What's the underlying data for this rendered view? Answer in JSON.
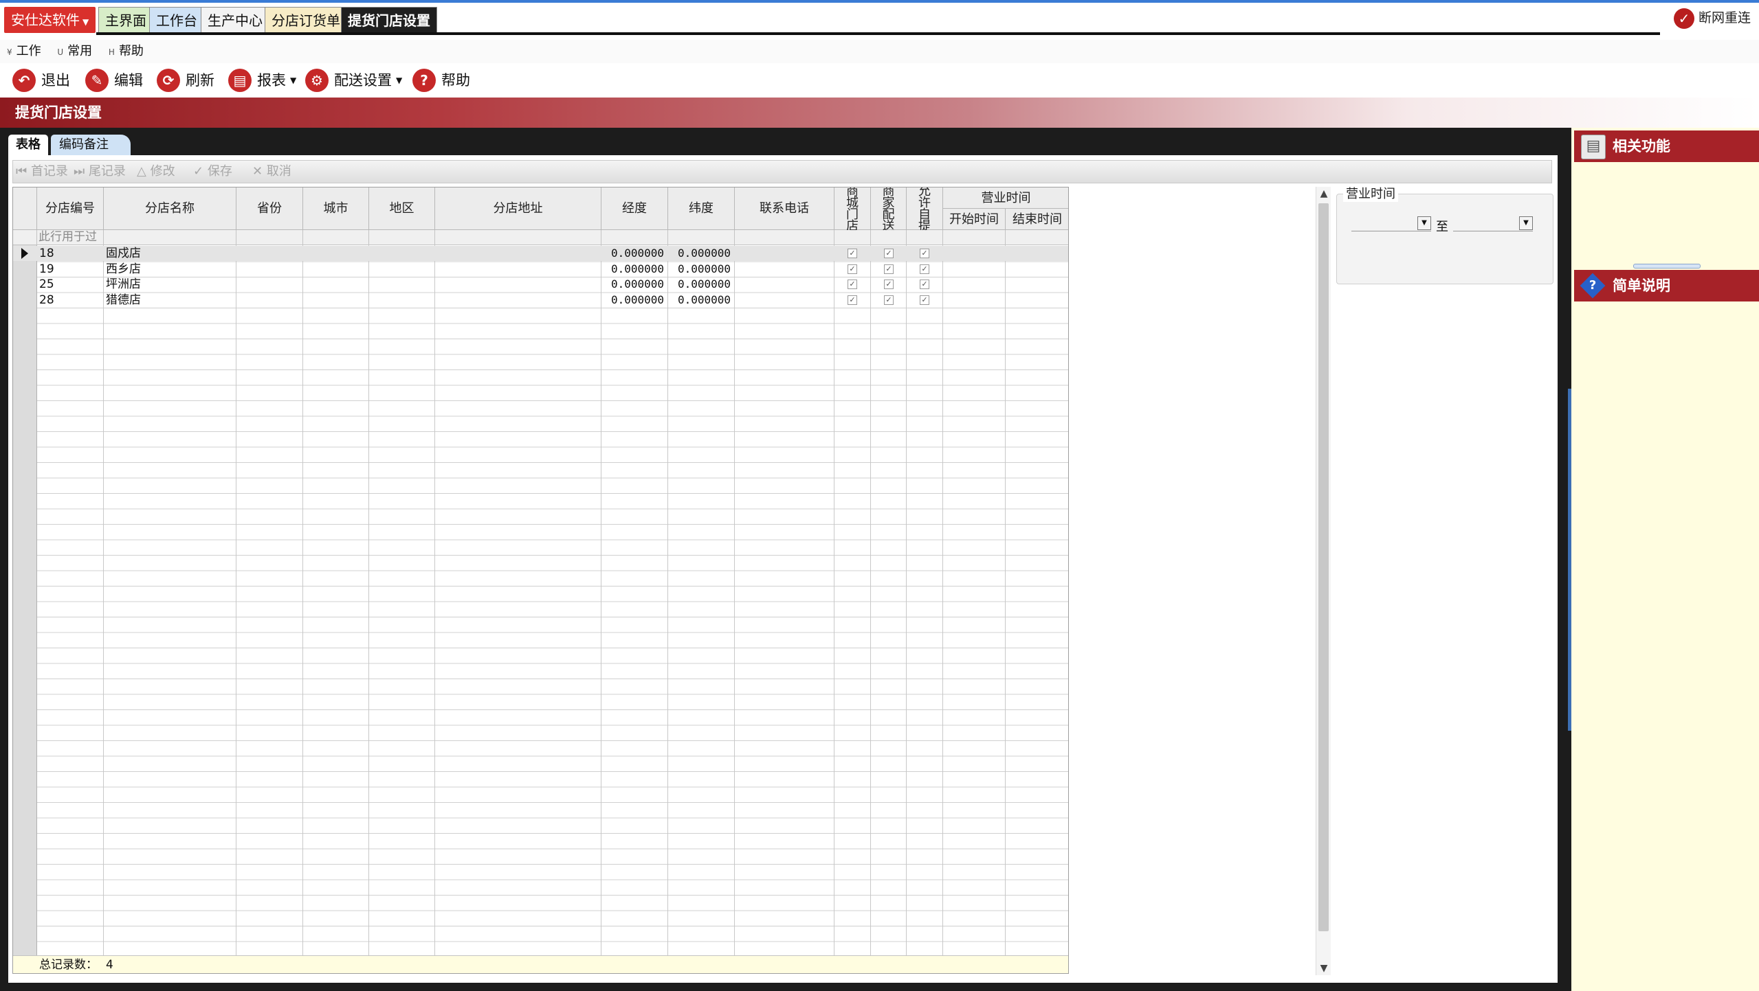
{
  "app": {
    "brand": "安仕达软件",
    "tabs": [
      "主界面",
      "工作台",
      "生产中心",
      "分店订货单",
      "提货门店设置"
    ],
    "active_tab": "提货门店设置",
    "reconnect_label": "断网重连"
  },
  "menu": [
    "工作",
    "常用",
    "帮助"
  ],
  "toolbar": {
    "exit": "退出",
    "edit": "编辑",
    "refresh": "刷新",
    "report": "报表",
    "delivery_settings": "配送设置",
    "help": "帮助"
  },
  "page_title": "提货门店设置",
  "subtabs": [
    "表格",
    "编码备注"
  ],
  "navigator": {
    "first": "首记录",
    "last": "尾记录",
    "modify": "修改",
    "save": "保存",
    "cancel": "取消"
  },
  "grid": {
    "columns": {
      "code": "分店编号",
      "name": "分店名称",
      "province": "省份",
      "city": "城市",
      "district": "地区",
      "address": "分店地址",
      "longitude": "经度",
      "latitude": "纬度",
      "phone": "联系电话",
      "mall_store": "商城门店",
      "merchant_delivery": "商家配送",
      "allow_pickup": "允许自提",
      "hours_group": "营业时间",
      "start_time": "开始时间",
      "end_time": "结束时间"
    },
    "filter_placeholder": "此行用于过",
    "rows": [
      {
        "code": "18",
        "name": "固戍店",
        "longitude": "0.000000",
        "latitude": "0.000000",
        "mall_store": true,
        "merchant_delivery": true,
        "allow_pickup": true
      },
      {
        "code": "19",
        "name": "西乡店",
        "longitude": "0.000000",
        "latitude": "0.000000",
        "mall_store": true,
        "merchant_delivery": true,
        "allow_pickup": true
      },
      {
        "code": "25",
        "name": "坪洲店",
        "longitude": "0.000000",
        "latitude": "0.000000",
        "mall_store": true,
        "merchant_delivery": true,
        "allow_pickup": true
      },
      {
        "code": "28",
        "name": "猎德店",
        "longitude": "0.000000",
        "latitude": "0.000000",
        "mall_store": true,
        "merchant_delivery": true,
        "allow_pickup": true
      }
    ],
    "footer_label": "总记录数：",
    "footer_count": "4"
  },
  "hours_panel": {
    "legend": "营业时间",
    "to_label": "至",
    "from_value": "",
    "to_value": ""
  },
  "right_panels": {
    "related": "相关功能",
    "notes": "简单说明"
  },
  "colors": {
    "brand_red": "#d9302c",
    "header_red": "#8e1a1f",
    "panel_yellow": "#fffde0",
    "active_tab_bg": "#1f1f1f"
  }
}
